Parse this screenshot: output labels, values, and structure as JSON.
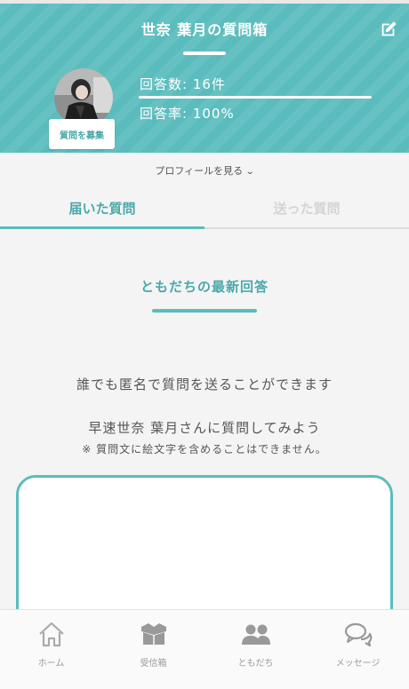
{
  "header": {
    "title": "世奈 葉月の質問箱",
    "edit_icon": "edit-icon",
    "recruit_button": "質問を募集",
    "answer_count": "回答数: 16件",
    "answer_rate": "回答率: 100%",
    "accent_color": "#5bbcbd"
  },
  "profile_link": {
    "label": "プロフィールを見る",
    "icon": "chevron-down-icon"
  },
  "tabs": [
    {
      "label": "届いた質問",
      "active": true
    },
    {
      "label": "送った質問",
      "active": false
    }
  ],
  "section": {
    "title": "ともだちの最新回答"
  },
  "messages": {
    "anonymous_note": "誰でも匿名で質問を送ることができます",
    "prompt": "早速世奈 葉月さんに質問してみよう",
    "emoji_note": "※ 質問文に絵文字を含めることはできません。"
  },
  "question_input": {
    "value": "",
    "placeholder": ""
  },
  "bottom_nav": [
    {
      "label": "ホーム",
      "icon": "home-icon"
    },
    {
      "label": "受信箱",
      "icon": "inbox-icon"
    },
    {
      "label": "ともだち",
      "icon": "friends-icon"
    },
    {
      "label": "メッセージ",
      "icon": "message-icon"
    }
  ]
}
